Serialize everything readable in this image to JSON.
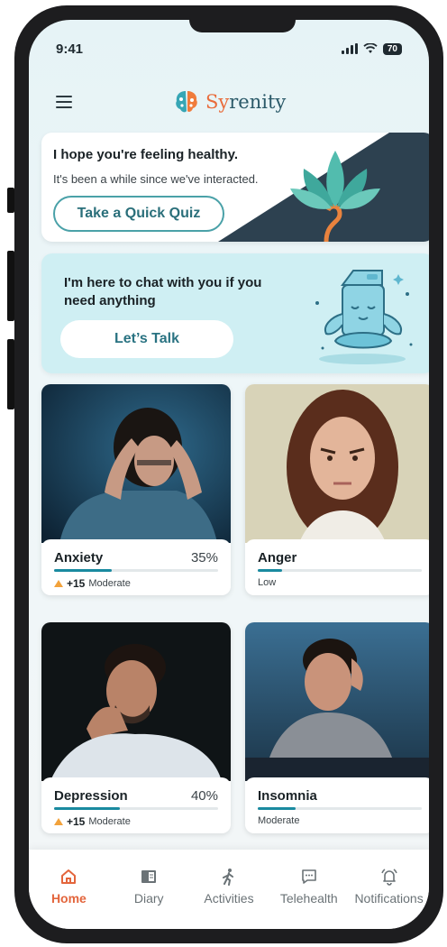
{
  "status": {
    "time": "9:41",
    "battery": "70"
  },
  "brand": {
    "name_prefix": "Sy",
    "name_rest": "renity"
  },
  "quiz_card": {
    "title": "I hope you're feeling healthy.",
    "subtitle": "It's been a while since we've interacted.",
    "button": "Take a Quick Quiz"
  },
  "talk_card": {
    "title": "I'm here to chat with you if you need anything",
    "button": "Let’s Talk"
  },
  "conditions": [
    {
      "name": "Anxiety",
      "percent": "35%",
      "delta": "+15",
      "level": "Moderate",
      "fill": 0.35
    },
    {
      "name": "Anger",
      "percent": "",
      "delta": "",
      "level": "Low",
      "fill": 0.15
    },
    {
      "name": "Depression",
      "percent": "40%",
      "delta": "+15",
      "level": "Moderate",
      "fill": 0.4
    },
    {
      "name": "Insomnia",
      "percent": "",
      "delta": "",
      "level": "Moderate",
      "fill": 0.23
    }
  ],
  "tabs": [
    {
      "label": "Home",
      "icon": "home-icon",
      "active": true
    },
    {
      "label": "Diary",
      "icon": "diary-icon",
      "active": false
    },
    {
      "label": "Activities",
      "icon": "activities-icon",
      "active": false
    },
    {
      "label": "Telehealth",
      "icon": "telehealth-icon",
      "active": false
    },
    {
      "label": "Notifications",
      "icon": "notifications-icon",
      "active": false
    }
  ],
  "colors": {
    "accent": "#e3653c",
    "teal": "#1a8aa0",
    "dark_navy": "#2d4150"
  }
}
